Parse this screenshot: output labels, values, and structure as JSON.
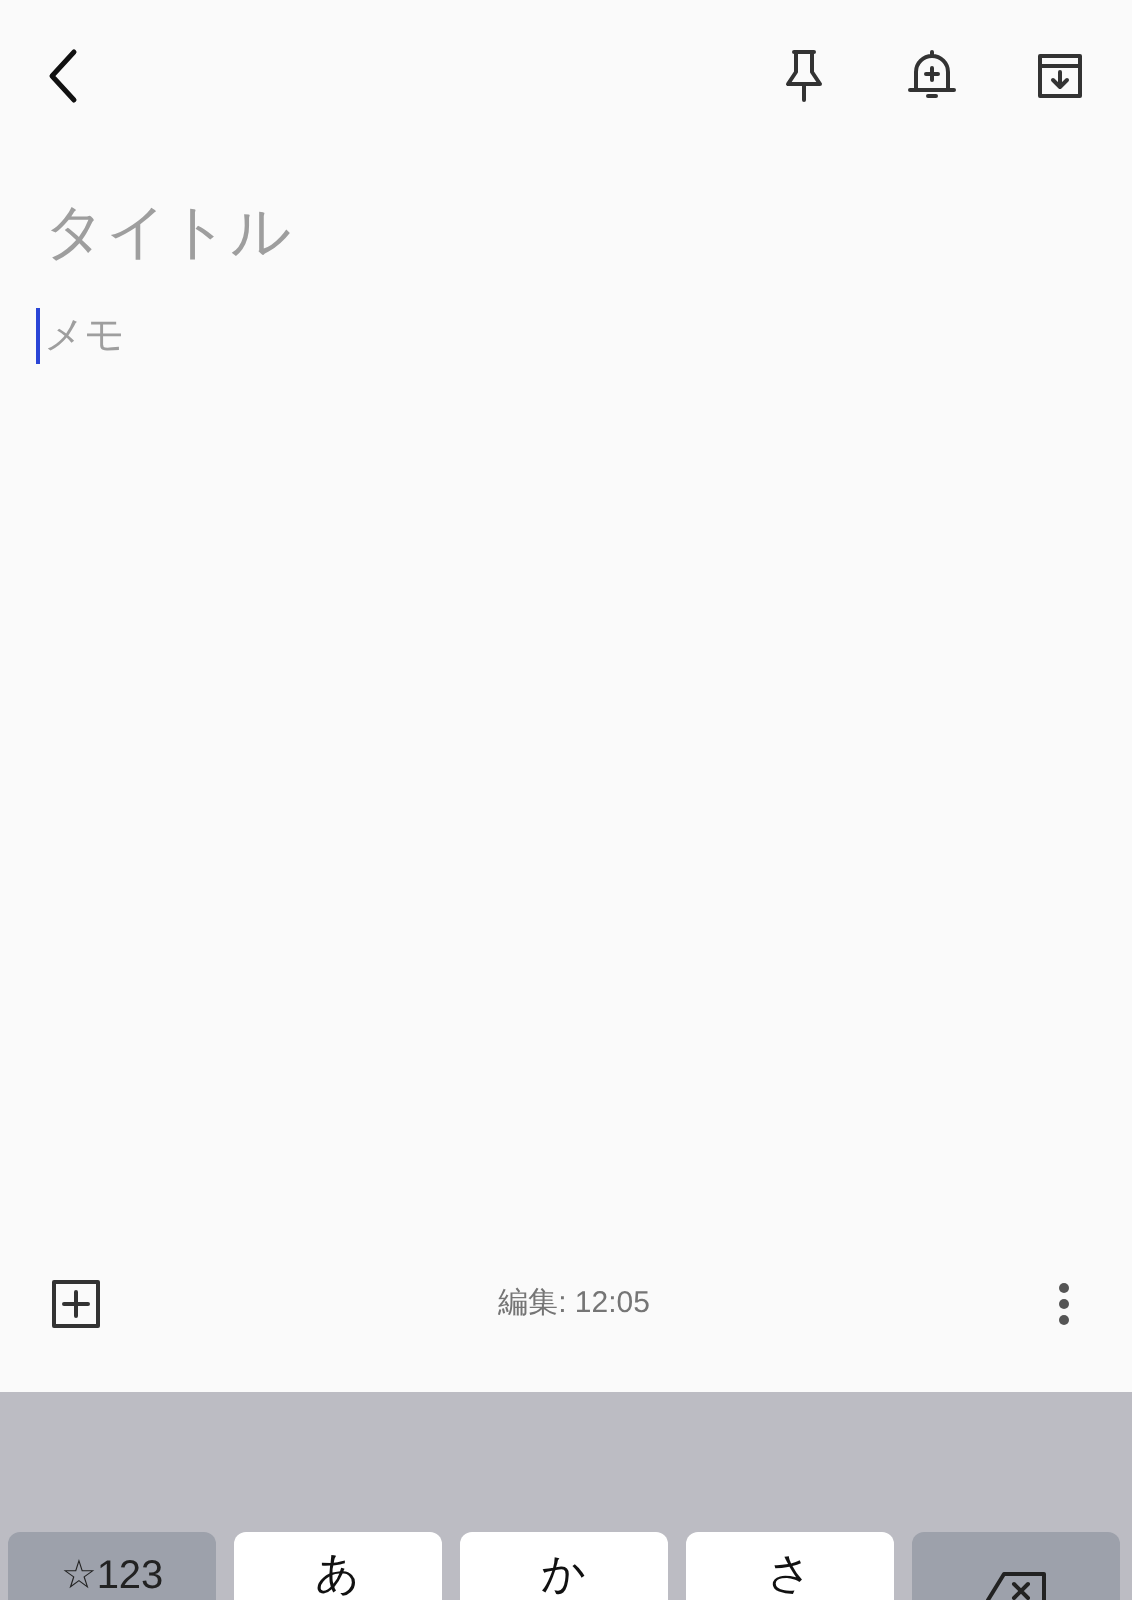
{
  "note": {
    "title_placeholder": "タイトル",
    "body_placeholder": "メモ",
    "body_focused": true
  },
  "footer": {
    "edited": "編集: 12:05"
  },
  "keyboard": {
    "keys": [
      {
        "kind": "function",
        "label": "☆123"
      },
      {
        "kind": "char",
        "label": "あ"
      },
      {
        "kind": "char",
        "label": "か"
      },
      {
        "kind": "char",
        "label": "さ"
      },
      {
        "kind": "delete"
      }
    ]
  }
}
